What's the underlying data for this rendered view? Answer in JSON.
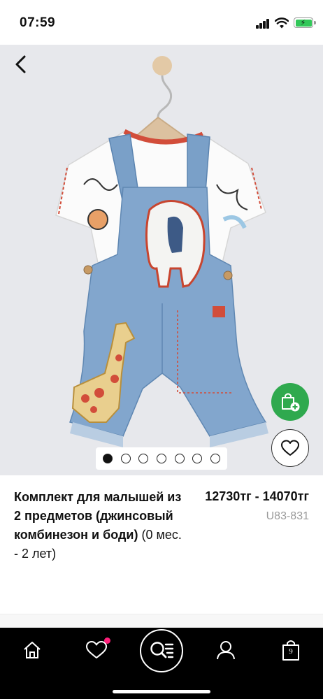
{
  "status_bar": {
    "time": "07:59",
    "icons": [
      "cellular-signal-icon",
      "wifi-icon",
      "battery-charging-icon"
    ],
    "battery_color": "#32c759"
  },
  "navigation": {
    "back_icon": "chevron-left-icon"
  },
  "gallery": {
    "image_count": 7,
    "active_index": 0,
    "background": "#e7e8ec"
  },
  "actions": {
    "add_to_cart_icon": "shopping-bag-add-icon",
    "add_to_cart_color": "#2fa94e",
    "wishlist_icon": "heart-outline-icon"
  },
  "product": {
    "title_bold": "Комплект для малышей из 2 предметов (джинсовый комбинезон и боди)",
    "title_regular": " (0 мес. - 2 лет)",
    "price": "12730тг - 14070тг",
    "sku": "U83-831"
  },
  "tab_bar": {
    "tabs": [
      {
        "name": "home",
        "icon": "home-icon"
      },
      {
        "name": "wishlist",
        "icon": "heart-icon",
        "badge_color": "#ff1e7a"
      },
      {
        "name": "search",
        "icon": "search-list-icon"
      },
      {
        "name": "account",
        "icon": "user-icon"
      },
      {
        "name": "bag",
        "icon": "shopping-bag-icon",
        "count": "9"
      }
    ]
  }
}
